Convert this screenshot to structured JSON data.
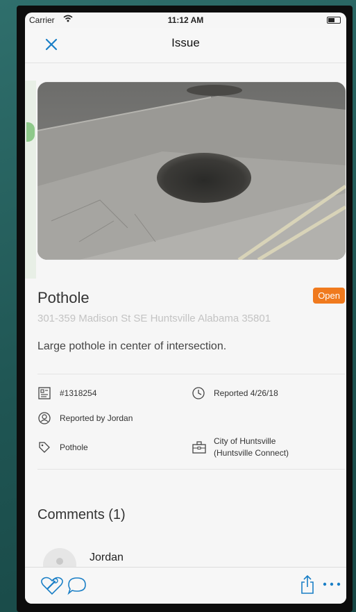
{
  "status_bar": {
    "carrier": "Carrier",
    "time": "11:12 AM"
  },
  "nav": {
    "title": "Issue"
  },
  "issue": {
    "title": "Pothole",
    "status": "Open",
    "address": "301-359 Madison St SE  Huntsville  Alabama  35801",
    "description": "Large pothole in center of intersection.",
    "id": "#1318254",
    "reported_date": "Reported 4/26/18",
    "reported_by": "Reported by Jordan",
    "category": "Pothole",
    "agency_line1": "City of Huntsville",
    "agency_line2": "(Huntsville Connect)"
  },
  "comments": {
    "heading": "Comments (1)",
    "items": [
      {
        "author": "Jordan"
      }
    ]
  },
  "colors": {
    "accent": "#1a7fc6",
    "status_open": "#f07a1e"
  },
  "icons": {
    "close": "close-icon",
    "id": "id-card-icon",
    "clock": "clock-icon",
    "user": "user-icon",
    "tag": "tag-icon",
    "briefcase": "briefcase-icon",
    "heart_wrench": "heart-wrench-icon",
    "comment": "comment-icon",
    "share": "share-icon",
    "more": "more-icon"
  }
}
